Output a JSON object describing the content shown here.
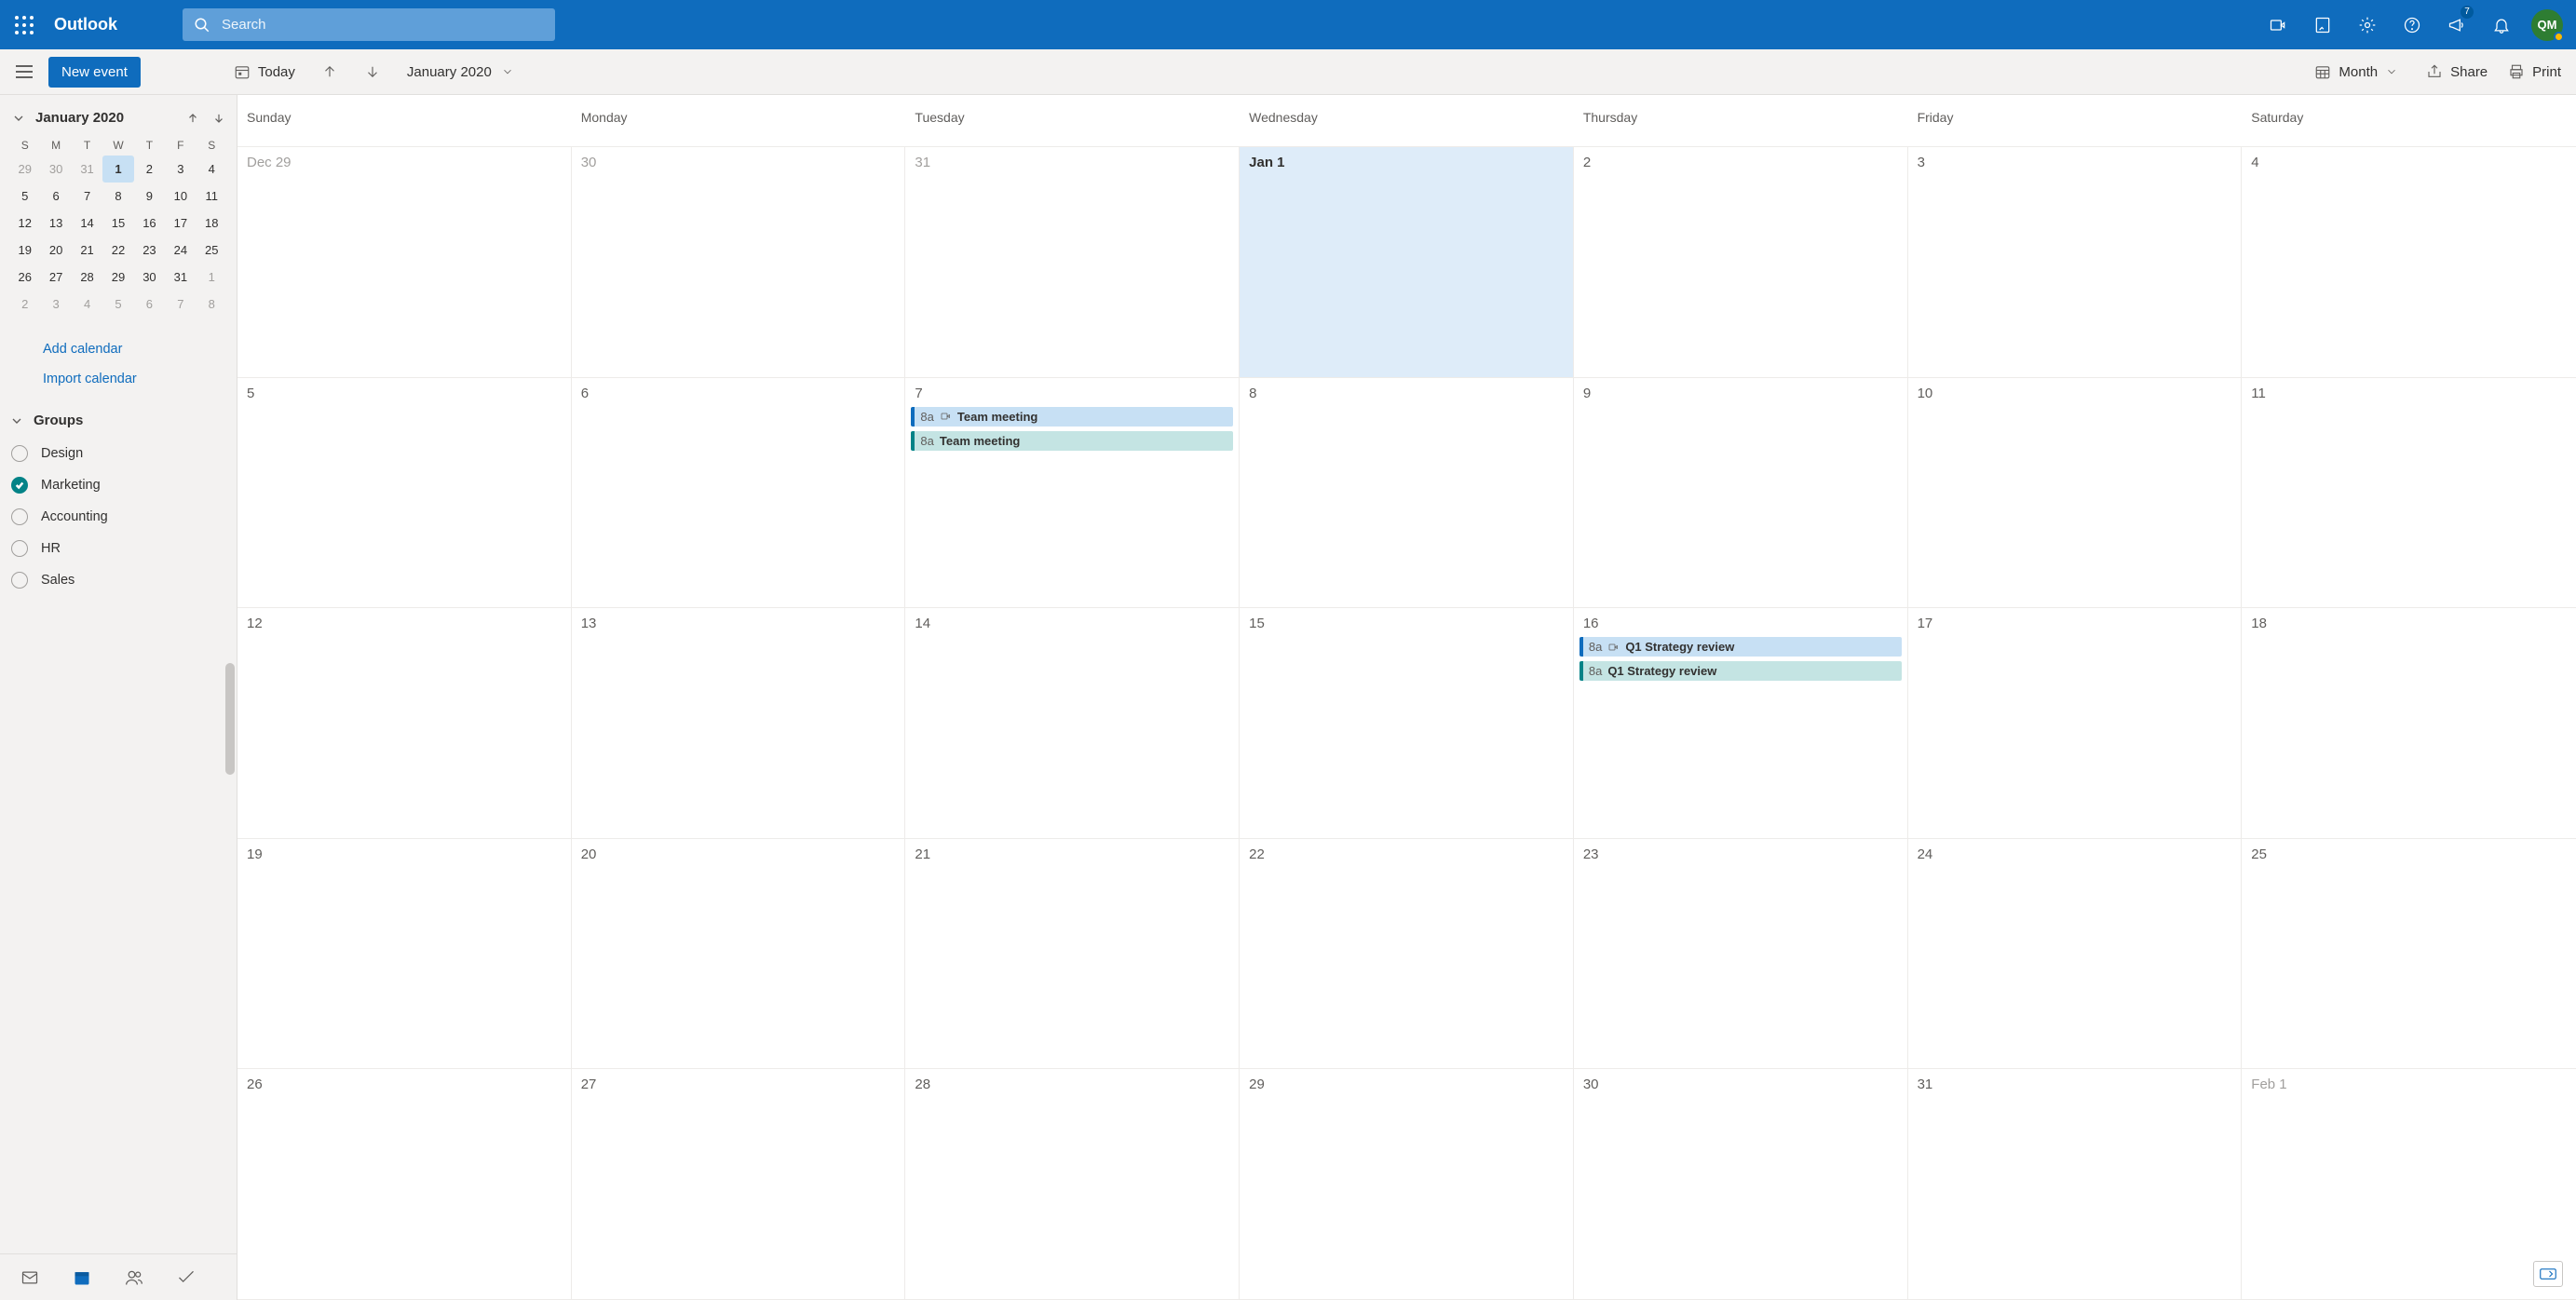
{
  "header": {
    "brand": "Outlook",
    "search_placeholder": "Search",
    "notification_badge": "7",
    "avatar_initials": "QM"
  },
  "toolbar": {
    "new_event": "New event",
    "today": "Today",
    "display_month": "January 2020",
    "view_label": "Month",
    "share": "Share",
    "print": "Print"
  },
  "mini_calendar": {
    "title": "January 2020",
    "dow": [
      "S",
      "M",
      "T",
      "W",
      "T",
      "F",
      "S"
    ],
    "rows": [
      [
        {
          "d": "29",
          "o": true
        },
        {
          "d": "30",
          "o": true
        },
        {
          "d": "31",
          "o": true
        },
        {
          "d": "1",
          "sel": true
        },
        {
          "d": "2"
        },
        {
          "d": "3"
        },
        {
          "d": "4"
        }
      ],
      [
        {
          "d": "5"
        },
        {
          "d": "6"
        },
        {
          "d": "7"
        },
        {
          "d": "8"
        },
        {
          "d": "9"
        },
        {
          "d": "10"
        },
        {
          "d": "11"
        }
      ],
      [
        {
          "d": "12"
        },
        {
          "d": "13"
        },
        {
          "d": "14"
        },
        {
          "d": "15"
        },
        {
          "d": "16"
        },
        {
          "d": "17"
        },
        {
          "d": "18"
        }
      ],
      [
        {
          "d": "19"
        },
        {
          "d": "20"
        },
        {
          "d": "21"
        },
        {
          "d": "22"
        },
        {
          "d": "23"
        },
        {
          "d": "24"
        },
        {
          "d": "25"
        }
      ],
      [
        {
          "d": "26"
        },
        {
          "d": "27"
        },
        {
          "d": "28"
        },
        {
          "d": "29"
        },
        {
          "d": "30"
        },
        {
          "d": "31"
        },
        {
          "d": "1",
          "o": true
        }
      ],
      [
        {
          "d": "2",
          "o": true
        },
        {
          "d": "3",
          "o": true
        },
        {
          "d": "4",
          "o": true
        },
        {
          "d": "5",
          "o": true
        },
        {
          "d": "6",
          "o": true
        },
        {
          "d": "7",
          "o": true
        },
        {
          "d": "8",
          "o": true
        }
      ]
    ]
  },
  "side_links": {
    "add": "Add calendar",
    "import": "Import calendar"
  },
  "groups_header": "Groups",
  "groups": [
    {
      "label": "Design",
      "on": false
    },
    {
      "label": "Marketing",
      "on": true
    },
    {
      "label": "Accounting",
      "on": false
    },
    {
      "label": "HR",
      "on": false
    },
    {
      "label": "Sales",
      "on": false
    }
  ],
  "calendar": {
    "dow": [
      "Sunday",
      "Monday",
      "Tuesday",
      "Wednesday",
      "Thursday",
      "Friday",
      "Saturday"
    ],
    "weeks": [
      [
        {
          "label": "Dec 29",
          "other": true
        },
        {
          "label": "30",
          "other": true
        },
        {
          "label": "31",
          "other": true
        },
        {
          "label": "Jan 1",
          "today": true
        },
        {
          "label": "2"
        },
        {
          "label": "3"
        },
        {
          "label": "4"
        }
      ],
      [
        {
          "label": "5"
        },
        {
          "label": "6"
        },
        {
          "label": "7",
          "events": [
            {
              "time": "8a",
              "title": "Team meeting",
              "color": "blue",
              "teams": true
            },
            {
              "time": "8a",
              "title": "Team meeting",
              "color": "teal",
              "teams": false
            }
          ]
        },
        {
          "label": "8"
        },
        {
          "label": "9"
        },
        {
          "label": "10"
        },
        {
          "label": "11"
        }
      ],
      [
        {
          "label": "12"
        },
        {
          "label": "13"
        },
        {
          "label": "14"
        },
        {
          "label": "15"
        },
        {
          "label": "16",
          "events": [
            {
              "time": "8a",
              "title": "Q1 Strategy review",
              "color": "blue",
              "teams": true
            },
            {
              "time": "8a",
              "title": "Q1 Strategy review",
              "color": "teal",
              "teams": false
            }
          ]
        },
        {
          "label": "17"
        },
        {
          "label": "18"
        }
      ],
      [
        {
          "label": "19"
        },
        {
          "label": "20"
        },
        {
          "label": "21"
        },
        {
          "label": "22"
        },
        {
          "label": "23"
        },
        {
          "label": "24"
        },
        {
          "label": "25"
        }
      ],
      [
        {
          "label": "26"
        },
        {
          "label": "27"
        },
        {
          "label": "28"
        },
        {
          "label": "29"
        },
        {
          "label": "30"
        },
        {
          "label": "31"
        },
        {
          "label": "Feb 1",
          "other": true
        }
      ]
    ]
  }
}
